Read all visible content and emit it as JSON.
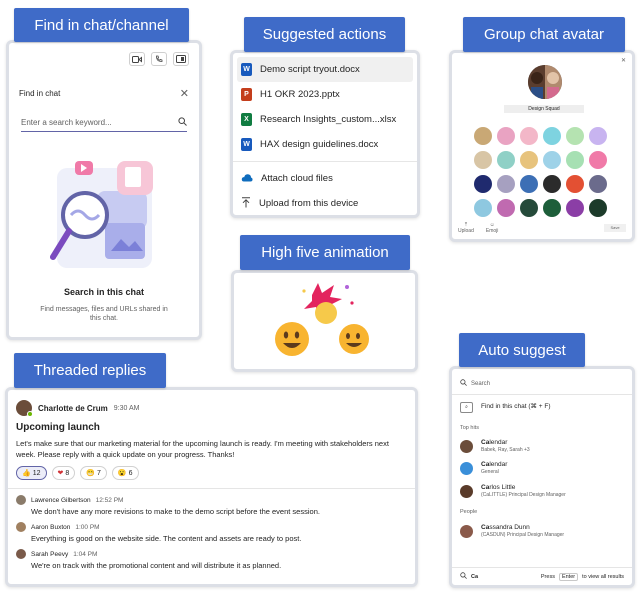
{
  "labels": {
    "find": "Find in chat/channel",
    "suggested": "Suggested actions",
    "avatar": "Group chat avatar",
    "high_five": "High five animation",
    "threaded": "Threaded replies",
    "auto": "Auto suggest"
  },
  "find_panel": {
    "header": "Find in chat",
    "placeholder": "Enter a search keyword...",
    "empty_title": "Search in this chat",
    "empty_sub": "Find messages, files and URLs shared in this chat."
  },
  "suggested_actions": {
    "files": [
      {
        "name": "Demo script tryout.docx",
        "type": "W",
        "color": "#185abd"
      },
      {
        "name": "H1 OKR 2023.pptx",
        "type": "P",
        "color": "#c43e1c"
      },
      {
        "name": "Research Insights_custom...xlsx",
        "type": "X",
        "color": "#107c41"
      },
      {
        "name": "HAX design guidelines.docx",
        "type": "W",
        "color": "#185abd"
      }
    ],
    "attach": "Attach cloud files",
    "upload": "Upload from this device"
  },
  "group_avatar": {
    "name": "Design Squad",
    "upload": "Upload",
    "emoji": "Emoji",
    "save": "Save",
    "avatars": [
      "#c9a875",
      "#e9a3c2",
      "#f3b7c8",
      "#7ed3e0",
      "#b5e3b1",
      "#c8b4f0",
      "#d8c5a5",
      "#8fd0c6",
      "#e7c37d",
      "#9ed2e8",
      "#a6e0b3",
      "#f07aa8",
      "#1f2a6e",
      "#a6a0c0",
      "#3c6fb5",
      "#2b2b2b",
      "#e35033",
      "#6b6b8c",
      "#8ec8e0",
      "#c06ab0",
      "#254a3a",
      "#1d5e3a",
      "#8b3ea6",
      "#1c3b2a"
    ]
  },
  "thread": {
    "author": "Charlotte de Crum",
    "time": "9:30 AM",
    "title": "Upcoming launch",
    "body": "Let's make sure that our marketing material for the upcoming launch is ready. I'm meeting with stakeholders next week. Please reply with a quick update on your progress. Thanks!",
    "reactions": [
      {
        "emoji": "👍",
        "count": "12"
      },
      {
        "emoji": "❤",
        "count": "8"
      },
      {
        "emoji": "😁",
        "count": "7"
      },
      {
        "emoji": "😮",
        "count": "6"
      }
    ],
    "replies": [
      {
        "name": "Lawrence Gilbertson",
        "time": "12:52 PM",
        "text": "We don't have any more revisions to make to the demo script before the event session.",
        "color": "#8a7b6a"
      },
      {
        "name": "Aaron Buxton",
        "time": "1:00 PM",
        "text": "Everything is good on the website side. The content and assets are ready to post.",
        "color": "#a08060"
      },
      {
        "name": "Sarah Peevy",
        "time": "1:04 PM",
        "text": "We're on track with the promotional content and will distribute it as planned.",
        "color": "#7a5a4a"
      }
    ]
  },
  "auto_suggest": {
    "search": "Search",
    "find_in_chat": "Find in this chat (⌘ + F)",
    "top_hits": "Top hits",
    "people": "People",
    "hits": [
      {
        "title_bold": "Ca",
        "title_rest": "lendar",
        "sub": "Babek, Ray, Sarah +3",
        "color": "#6b4d3a"
      },
      {
        "title_bold": "Ca",
        "title_rest": "lendar",
        "sub": "General",
        "color": "#3a8fd9"
      },
      {
        "title_bold": "Ca",
        "title_rest": "rlos Little",
        "sub": "(CaLITTLE) Principal Design Manager",
        "color": "#5a3b2a"
      }
    ],
    "person": {
      "title_bold": "Ca",
      "title_rest": "ssandra Dunn",
      "sub": "(CASDUN) Principal Design Manager",
      "color": "#8a5a4a"
    },
    "query": "Ca",
    "press": "Press",
    "enter": "Enter",
    "view_all": "to view all results"
  }
}
